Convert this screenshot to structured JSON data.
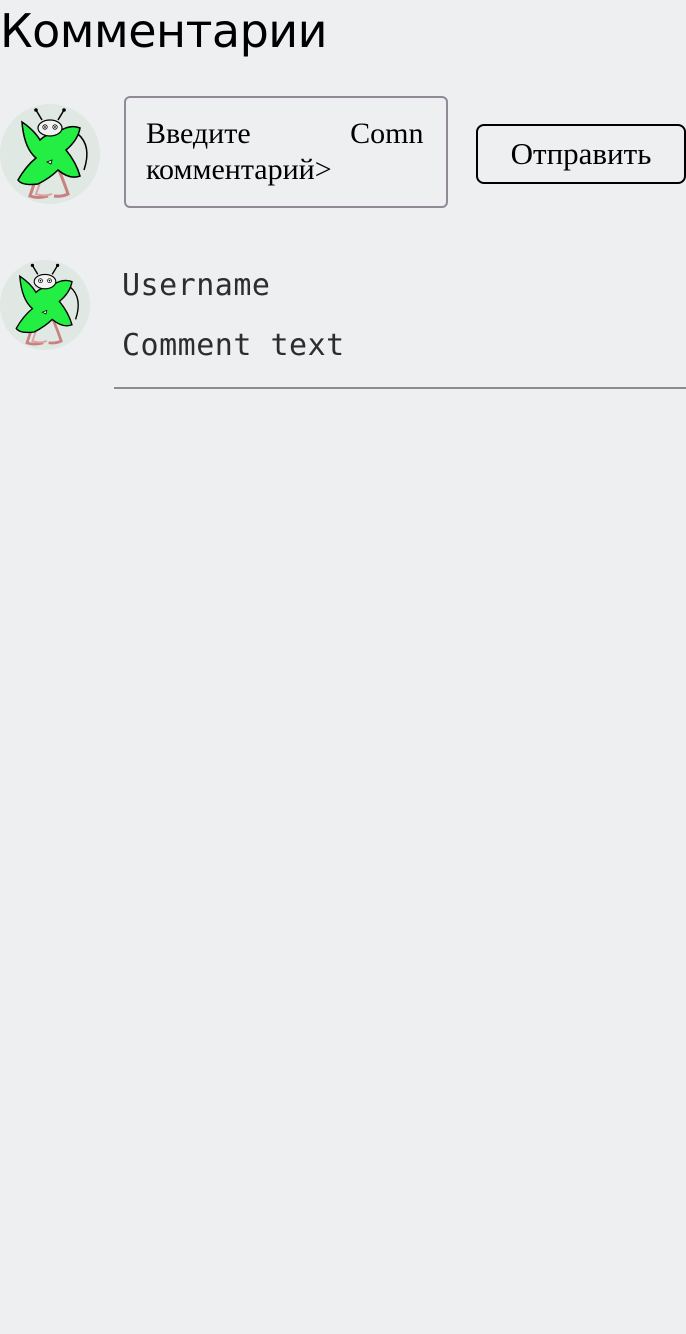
{
  "header": {
    "title": "Комментарии"
  },
  "new_comment": {
    "avatar_icon": "green-x-bug-avatar-icon",
    "input_text": "Введите Comn комментарий>",
    "send_label": "Отправить"
  },
  "comments": [
    {
      "avatar_icon": "green-x-bug-avatar-icon",
      "username": "Username",
      "text": "Comment text"
    }
  ],
  "colors": {
    "background": "#eeeff1",
    "avatar_green": "#22ee44",
    "divider": "#8c8c8c",
    "input_border": "#8f8a96"
  }
}
